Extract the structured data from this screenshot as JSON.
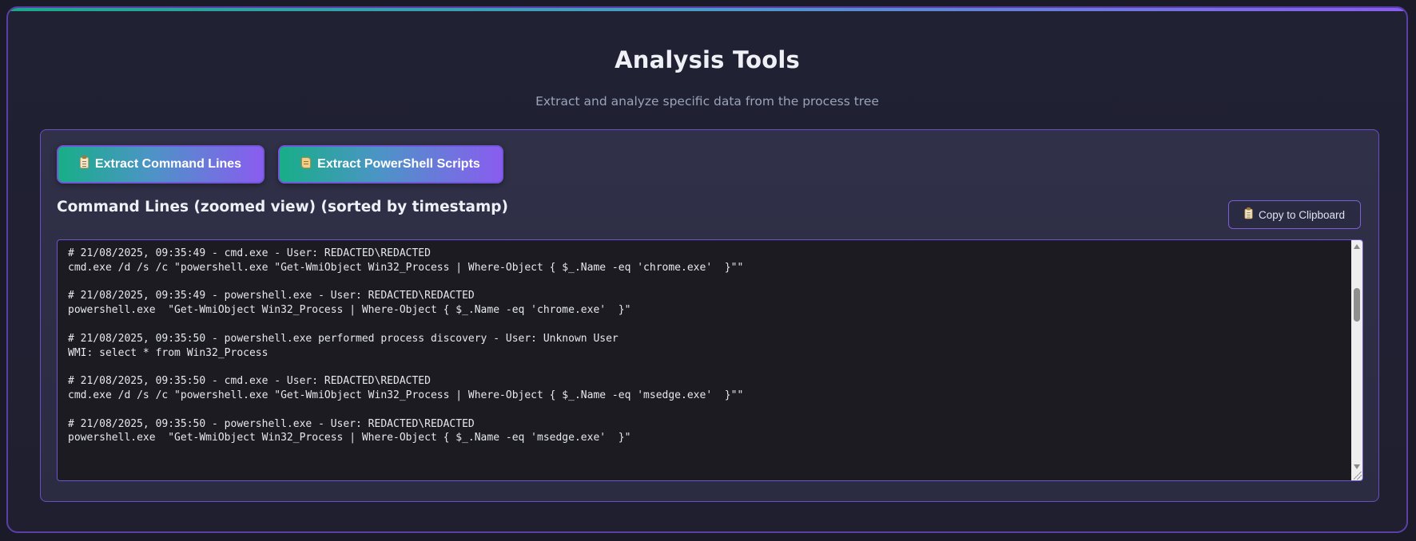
{
  "header": {
    "title": "Analysis Tools",
    "subtitle": "Extract and analyze specific data from the process tree"
  },
  "toolbar": {
    "extract_cmd_label": "Extract Command Lines",
    "extract_cmd_icon": "clipboard-icon",
    "extract_ps_label": "Extract PowerShell Scripts",
    "extract_ps_icon": "scroll-icon"
  },
  "results": {
    "title": "Command Lines (zoomed view) (sorted by timestamp)",
    "copy_label": "Copy to Clipboard",
    "copy_icon": "clipboard-icon",
    "output_text": "# 21/08/2025, 09:35:49 - cmd.exe - User: REDACTED\\REDACTED\ncmd.exe /d /s /c \"powershell.exe \"Get-WmiObject Win32_Process | Where-Object { $_.Name -eq 'chrome.exe'  }\"\"\n\n# 21/08/2025, 09:35:49 - powershell.exe - User: REDACTED\\REDACTED\npowershell.exe  \"Get-WmiObject Win32_Process | Where-Object { $_.Name -eq 'chrome.exe'  }\"\n\n# 21/08/2025, 09:35:50 - powershell.exe performed process discovery - User: Unknown User\nWMI: select * from Win32_Process\n\n# 21/08/2025, 09:35:50 - cmd.exe - User: REDACTED\\REDACTED\ncmd.exe /d /s /c \"powershell.exe \"Get-WmiObject Win32_Process | Where-Object { $_.Name -eq 'msedge.exe'  }\"\"\n\n# 21/08/2025, 09:35:50 - powershell.exe - User: REDACTED\\REDACTED\npowershell.exe  \"Get-WmiObject Win32_Process | Where-Object { $_.Name -eq 'msedge.exe'  }\""
  },
  "colors": {
    "accent_teal": "#18ae88",
    "accent_purple": "#8a5cf0",
    "background": "#1f1f30",
    "panel": "#2e2e46",
    "output_bg": "#1b1b21"
  }
}
